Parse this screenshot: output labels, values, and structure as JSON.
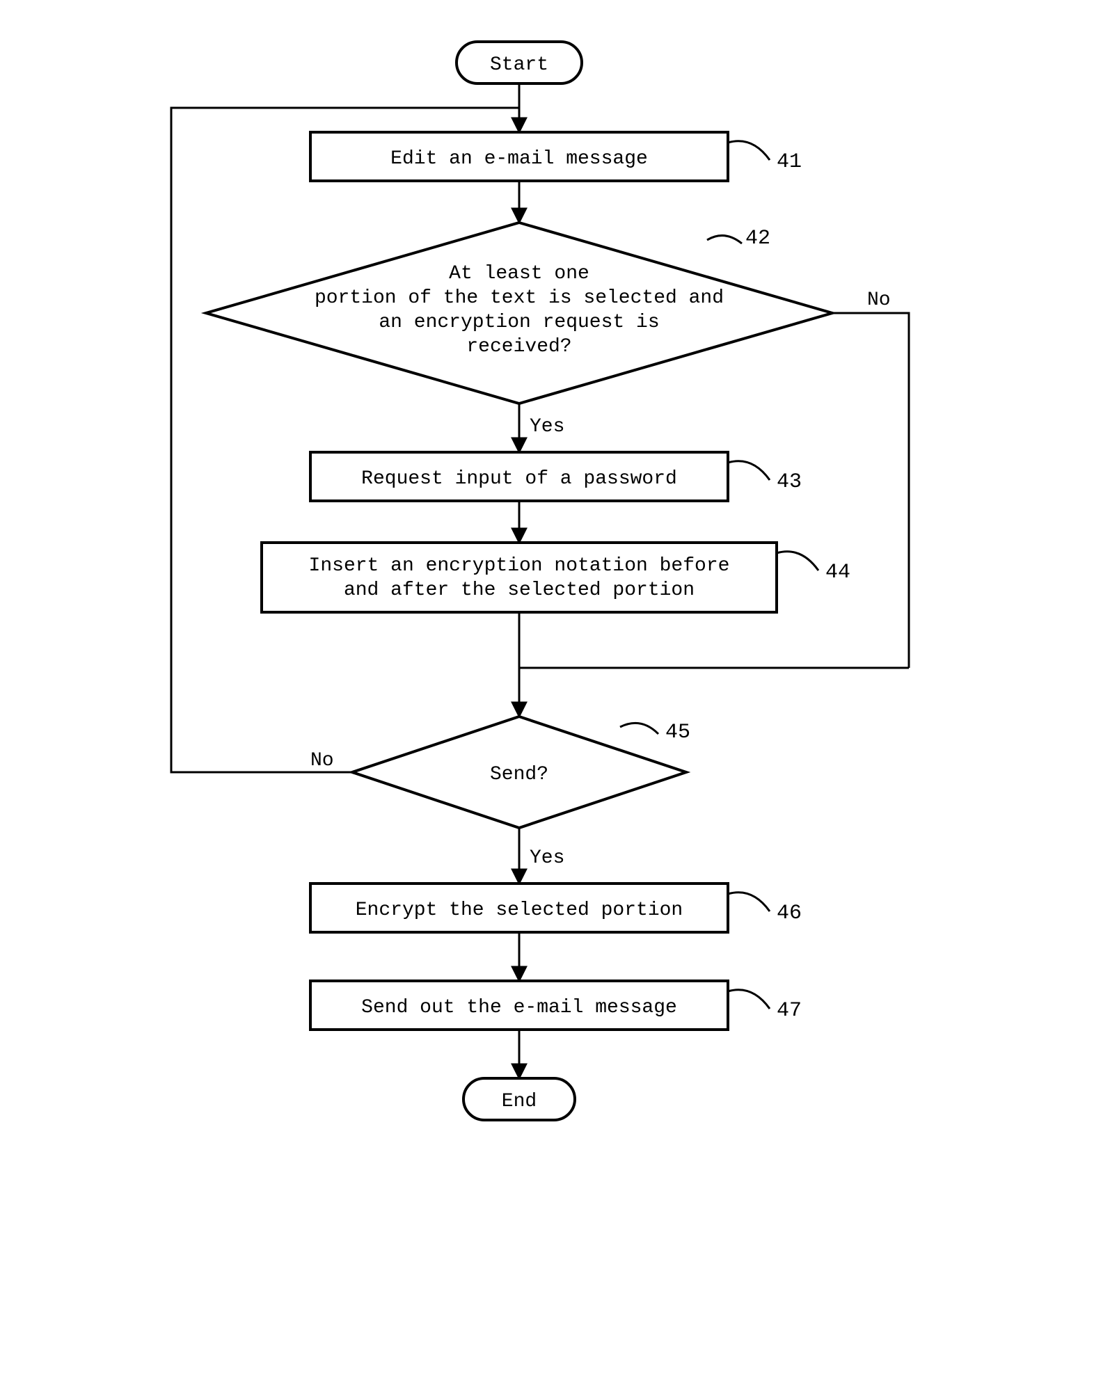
{
  "flow": {
    "start": "Start",
    "end": "End",
    "step41": "Edit an e-mail message",
    "step42_l1": "At least one",
    "step42_l2": "portion of the text is selected and",
    "step42_l3": "an encryption request is",
    "step42_l4": "received?",
    "step43": "Request input of a password",
    "step44_l1": "Insert an encryption notation before",
    "step44_l2": "and after the selected portion",
    "step45": "Send?",
    "step46": "Encrypt the selected portion",
    "step47": "Send out the e-mail message",
    "yes": "Yes",
    "no": "No",
    "ref41": "41",
    "ref42": "42",
    "ref43": "43",
    "ref44": "44",
    "ref45": "45",
    "ref46": "46",
    "ref47": "47"
  }
}
